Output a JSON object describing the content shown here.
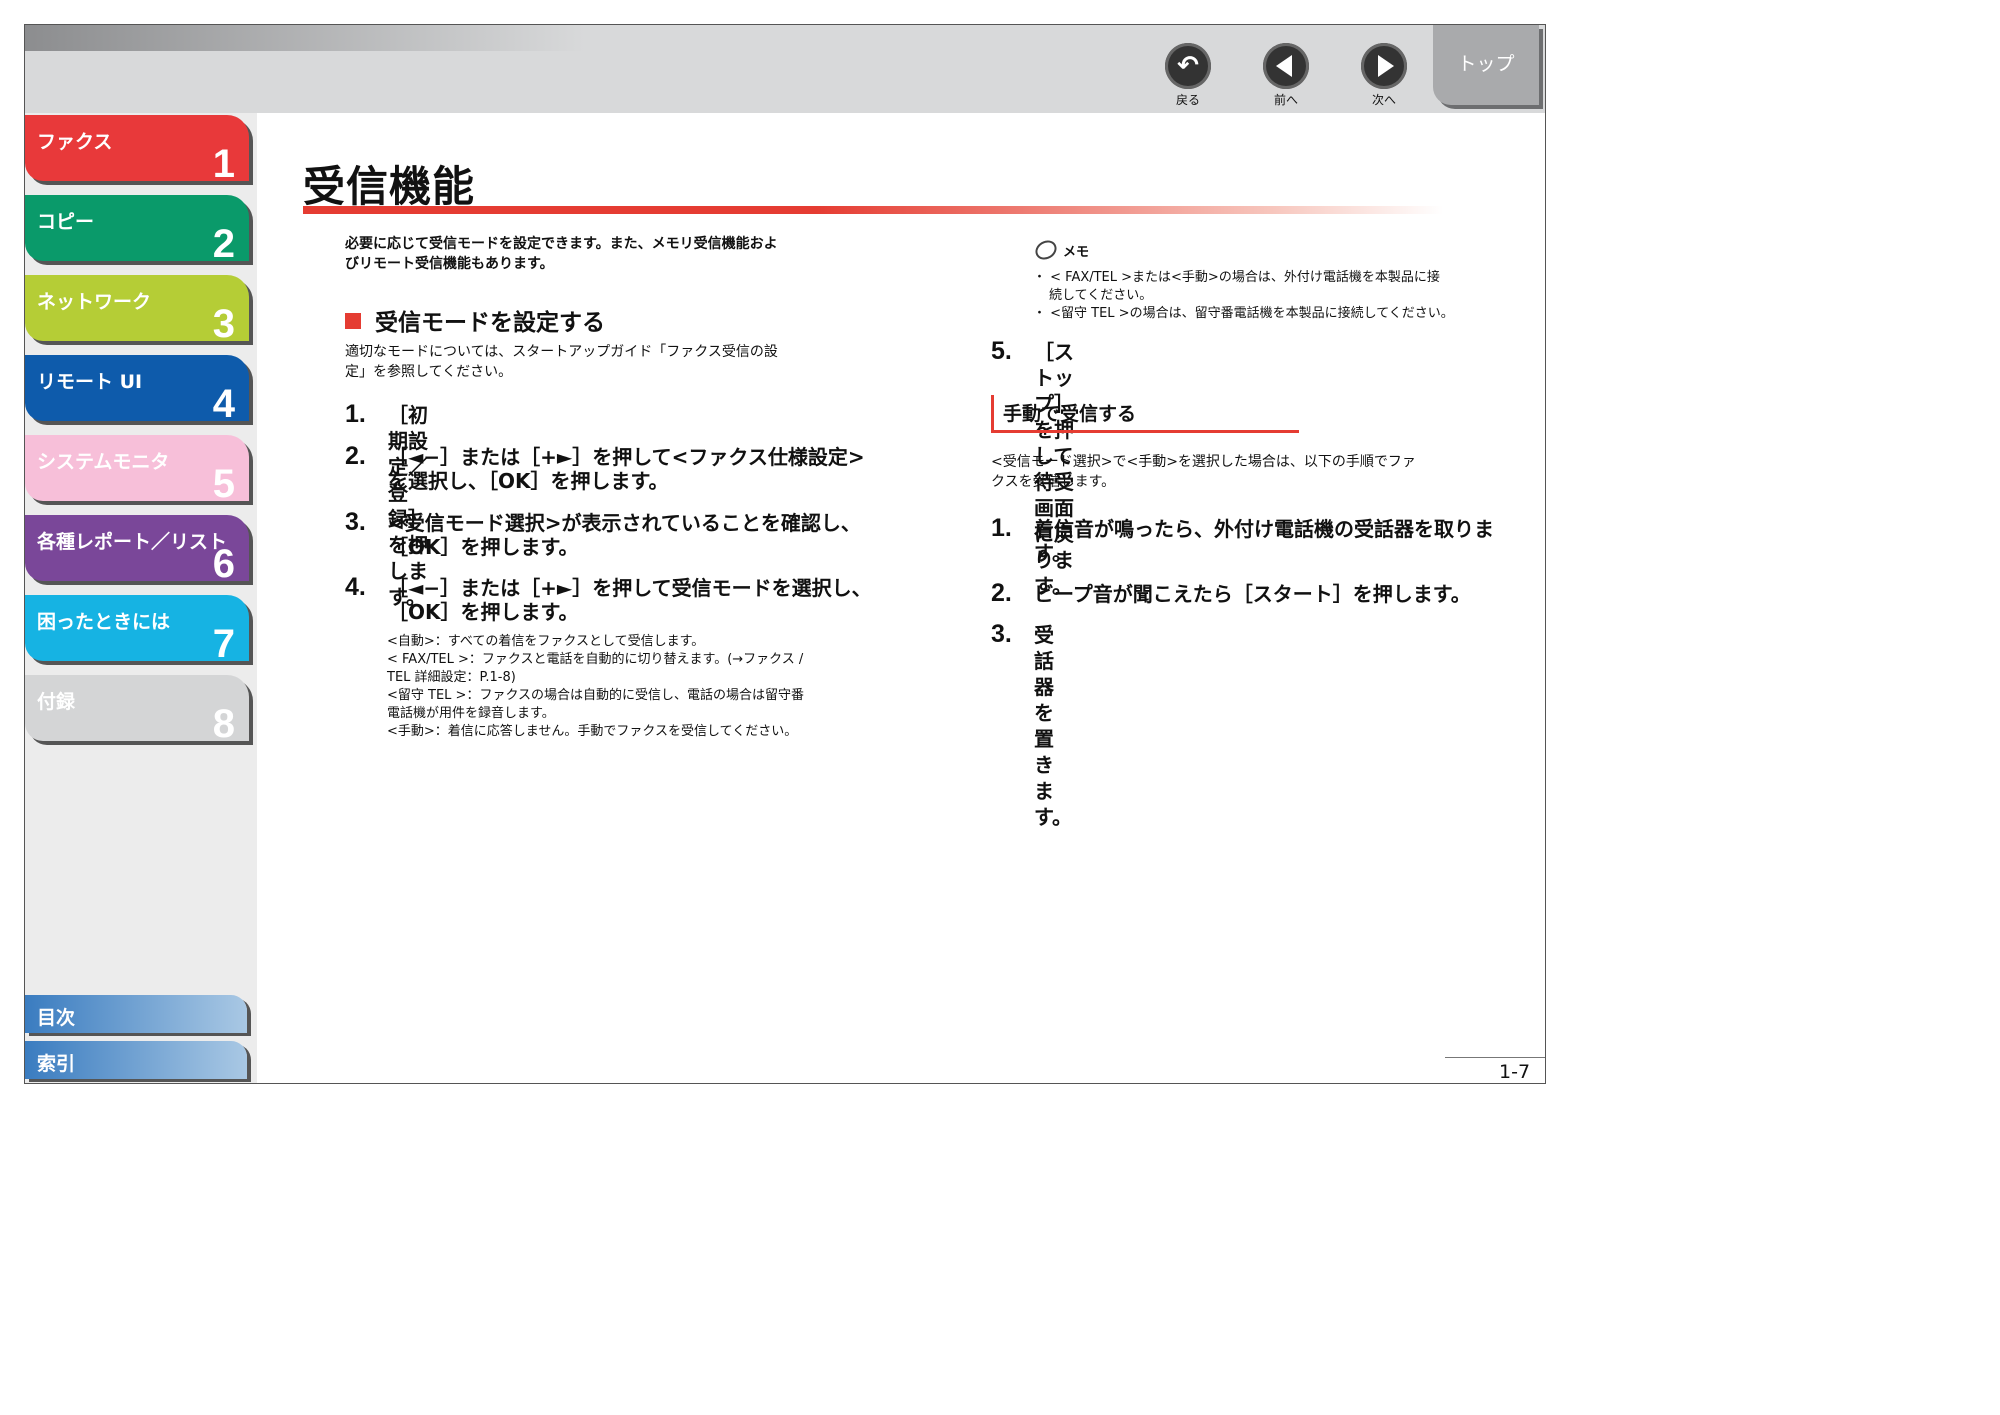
{
  "nav": {
    "back_label": "戻る",
    "prev_label": "前へ",
    "next_label": "次へ",
    "top_label": "トップ"
  },
  "sidebar": {
    "tabs": [
      {
        "label": "ファクス",
        "num": "1",
        "color": "#e8393a"
      },
      {
        "label": "コピー",
        "num": "2",
        "color": "#0a9a6a"
      },
      {
        "label": "ネットワーク",
        "num": "3",
        "color": "#b5cd36"
      },
      {
        "label": "リモート UI",
        "num": "4",
        "color": "#0e5bab"
      },
      {
        "label": "システムモニタ",
        "num": "5",
        "color": "#f7bfd9"
      },
      {
        "label": "各種レポート／リスト",
        "num": "6",
        "color": "#7a4799"
      },
      {
        "label": "困ったときには",
        "num": "7",
        "color": "#16b3e3"
      },
      {
        "label": "付録",
        "num": "8",
        "color": "#d4d5d6"
      }
    ],
    "contents_label": "目次",
    "index_label": "索引"
  },
  "page": {
    "title": "受信機能",
    "intro_1": "必要に応じて受信モードを設定できます。また、メモリ受信機能およ",
    "intro_2": "びリモート受信機能もあります。",
    "section_title": "受信モードを設定する",
    "section_desc_1": "適切なモードについては、スタートアップガイド「ファクス受信の設",
    "section_desc_2": "定」を参照してください。",
    "steps_left": [
      {
        "n": "1.",
        "lines": [
          "［初期設定／登録］を押します。"
        ]
      },
      {
        "n": "2.",
        "lines": [
          "［◄−］または［+►］を押して<ファクス仕様設定>",
          "を選択し、［OK］を押します。"
        ]
      },
      {
        "n": "3.",
        "lines": [
          "<受信モード選択>が表示されていることを確認し、",
          "［OK］を押します。"
        ]
      },
      {
        "n": "4.",
        "lines": [
          "［◄−］または［+►］を押して受信モードを選択し、",
          "［OK］を押します。"
        ]
      }
    ],
    "mode_notes": [
      "<自動>：すべての着信をファクスとして受信します。",
      "< FAX/TEL >：ファクスと電話を自動的に切り替えます。(→ファクス /",
      "TEL 詳細設定：P.1-8)",
      "<留守 TEL >：ファクスの場合は自動的に受信し、電話の場合は留守番",
      "電話機が用件を録音します。",
      "<手動>：着信に応答しません。手動でファクスを受信してください。"
    ],
    "memo_label": "メモ",
    "memo_items": [
      "・ < FAX/TEL >または<手動>の場合は、外付け電話機を本製品に接",
      "続してください。",
      "・ <留守 TEL >の場合は、留守番電話機を本製品に接続してください。"
    ],
    "step5": {
      "n": "5.",
      "text": "［ストップ］を押して待受画面に戻ります。"
    },
    "manual_title": "手動で受信する",
    "manual_desc_1": "<受信モード選択>で<手動>を選択した場合は、以下の手順でファ",
    "manual_desc_2": "クスを受信します。",
    "steps_right": [
      {
        "n": "1.",
        "lines": [
          "着信音が鳴ったら、外付け電話機の受話器を取りま",
          "す。"
        ]
      },
      {
        "n": "2.",
        "lines": [
          "ビープ音が聞こえたら［スタート］を押します。"
        ]
      },
      {
        "n": "3.",
        "lines": [
          "受話器を置きます。"
        ]
      }
    ],
    "page_number": "1-7"
  }
}
